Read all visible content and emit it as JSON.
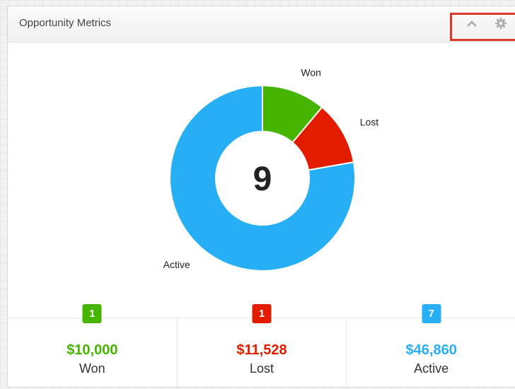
{
  "dashlet": {
    "title": "Opportunity Metrics",
    "collapse_icon": "chevron-up-icon",
    "settings_icon": "gear-icon",
    "highlight_color": "#e0392c"
  },
  "chart_data": {
    "type": "pie",
    "center_label": "9",
    "categories": [
      "Won",
      "Lost",
      "Active"
    ],
    "values": [
      1,
      1,
      7
    ],
    "colors": [
      "#45b500",
      "#e31c00",
      "#27aff5"
    ]
  },
  "summary": [
    {
      "count": "1",
      "amount": "$10,000",
      "label": "Won",
      "color": "#45b500"
    },
    {
      "count": "1",
      "amount": "$11,528",
      "label": "Lost",
      "color": "#e31c00"
    },
    {
      "count": "7",
      "amount": "$46,860",
      "label": "Active",
      "color": "#27aff5"
    }
  ]
}
